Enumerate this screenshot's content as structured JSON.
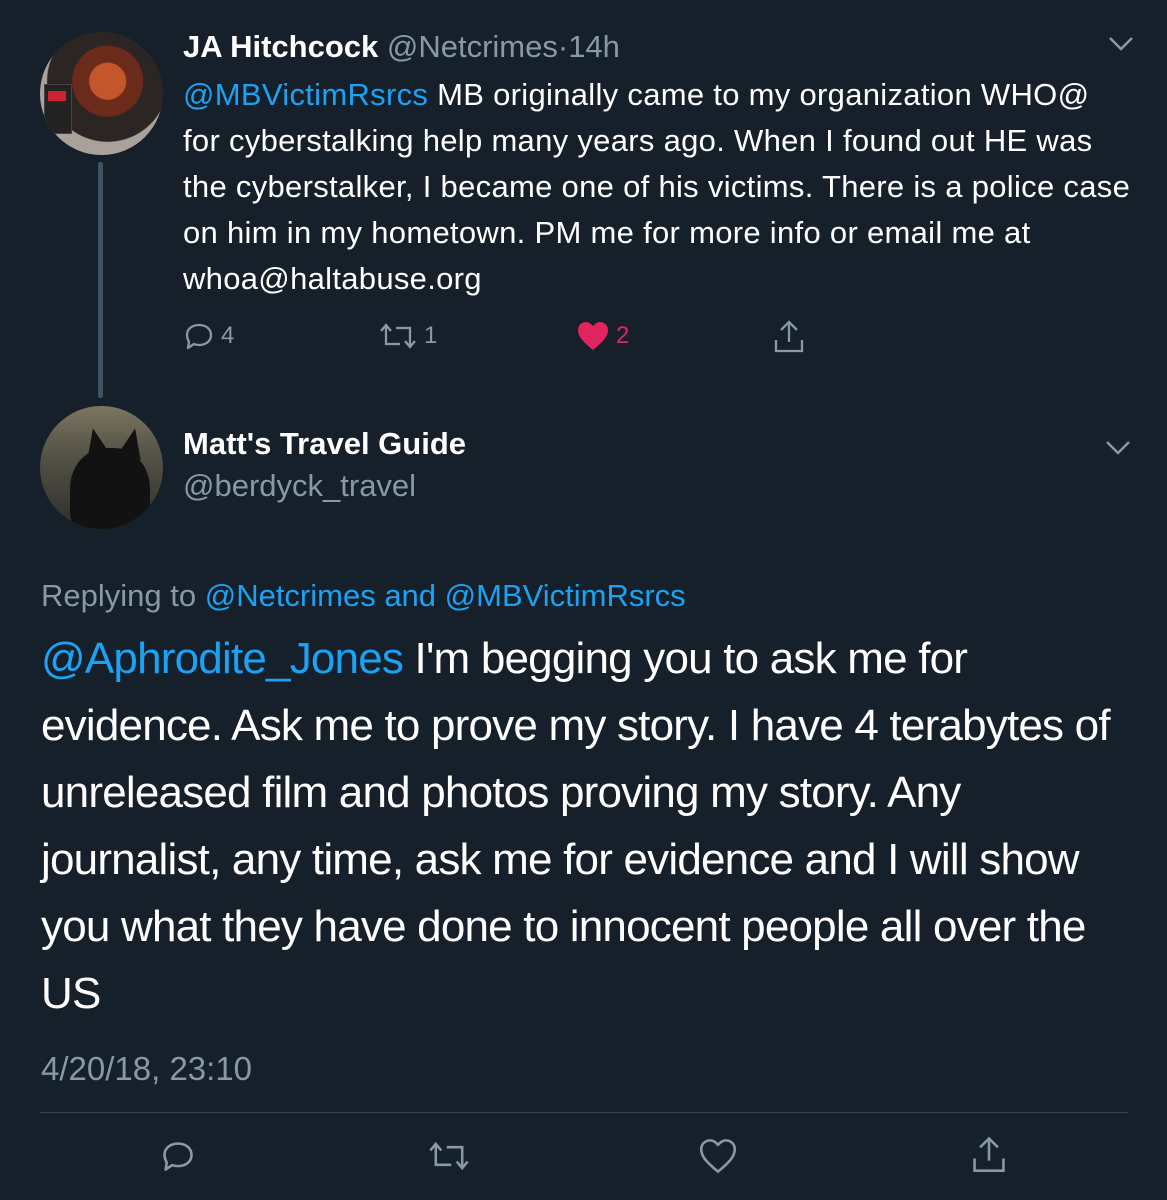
{
  "colors": {
    "background": "#15202b",
    "muted": "#8899a6",
    "link": "#1da1f2",
    "like_active": "#e0245e",
    "divider": "#38444d"
  },
  "parent_tweet": {
    "author_name": "JA Hitchcock",
    "handle": "@Netcrimes",
    "separator": "·",
    "time_ago": "14h",
    "mention": "@MBVictimRsrcs",
    "text": " MB originally came to my organization WHO@ for cyberstalking help many years ago. When I found out HE was the cyberstalker, I became one of his victims. There is a police case on him in my hometown. PM me for  more info or email me at whoa@haltabuse.org",
    "replies_count": "4",
    "retweets_count": "1",
    "likes_count": "2",
    "avatar_icon": "profile-photo-woman-with-book",
    "menu_icon": "chevron-down-icon"
  },
  "reply_tweet": {
    "author_name": "Matt's Travel Guide",
    "handle": "@berdyck_travel",
    "replying_prefix": "Replying to ",
    "replying_users": "@Netcrimes and @MBVictimRsrcs",
    "mention": "@Aphrodite_Jones",
    "text": " I'm begging you to ask me for evidence.  Ask me to prove my story.  I have 4 terabytes of unreleased film and photos proving my story.  Any journalist, any time, ask me for evidence and I will show you what they have done to innocent people all over the US",
    "timestamp": "4/20/18, 23:10",
    "avatar_icon": "profile-photo-black-cat",
    "menu_icon": "chevron-down-icon"
  },
  "action_icons": [
    "reply-icon",
    "retweet-icon",
    "like-icon",
    "share-icon"
  ]
}
